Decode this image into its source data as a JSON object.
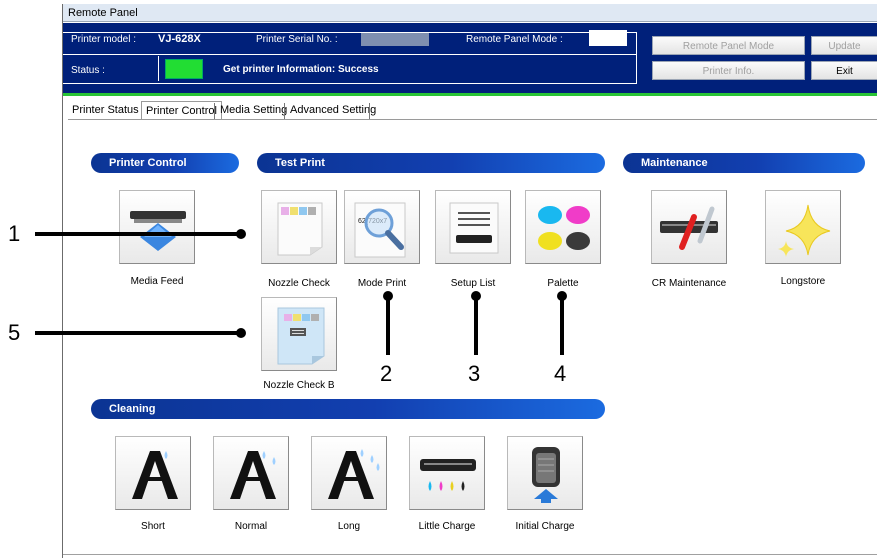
{
  "window": {
    "title": "Remote Panel"
  },
  "header": {
    "model_label": "Printer model :",
    "model_value": "VJ-628X",
    "serial_label": "Printer Serial No. :",
    "mode_label": "Remote Panel Mode :",
    "status_label": "Status :",
    "status_message": "Get printer Information: Success",
    "buttons": {
      "remote_panel_mode": "Remote Panel Mode",
      "update": "Update",
      "printer_info": "Printer Info.",
      "exit": "Exit"
    },
    "colors": {
      "background": "#00207a",
      "status_ok": "#22dd33",
      "accent_bar": "#29c435"
    }
  },
  "tabs": [
    "Printer Status",
    "Printer Control",
    "Media Setting",
    "Advanced Setting"
  ],
  "active_tab": "Printer Control",
  "sections": {
    "printer_control": "Printer Control",
    "test_print": "Test Print",
    "maintenance": "Maintenance",
    "cleaning": "Cleaning"
  },
  "printer_control": {
    "media_feed": "Media Feed"
  },
  "test_print": {
    "nozzle_check": "Nozzle Check",
    "mode_print": "Mode Print",
    "mode_print_icon_text": "62(720x7",
    "setup_list": "Setup List",
    "palette": "Palette",
    "nozzle_check_b": "Nozzle Check B"
  },
  "maintenance": {
    "cr_maintenance": "CR Maintenance",
    "longstore": "Longstore"
  },
  "cleaning": {
    "short": "Short",
    "normal": "Normal",
    "long": "Long",
    "little_charge": "Little Charge",
    "initial_charge": "Initial Charge"
  },
  "callouts": [
    "1",
    "2",
    "3",
    "4",
    "5"
  ]
}
